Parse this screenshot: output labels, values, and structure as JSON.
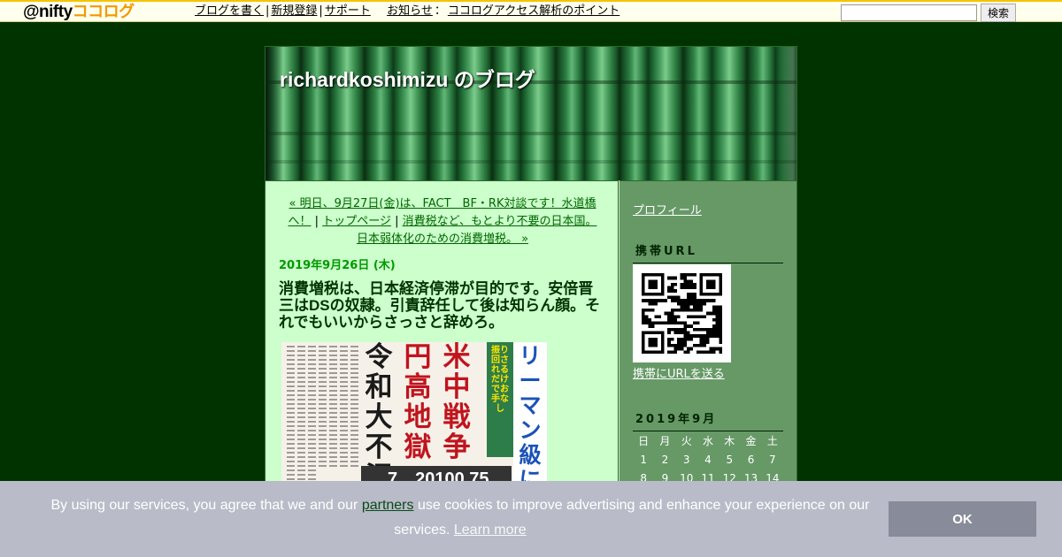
{
  "topbar": {
    "logo_at": "@nifty",
    "logo_kana": "ココログ",
    "nav": [
      {
        "label": "ブログを書く"
      },
      {
        "label": "新規登録"
      },
      {
        "label": "サポート"
      }
    ],
    "news_label": "お知らせ",
    "news_link": "ココログアクセス解析のポイント",
    "search_placeholder": "",
    "search_button": "検索"
  },
  "blog": {
    "title": "richardkoshimizu のブログ"
  },
  "pager": {
    "prev": "« 明日、9月27日(金)は、FACT　BF・RK対談です！水道橋へ！",
    "home": "トップページ",
    "next": "消費税など、もとより不要の日本国。日本弱体化のための消費増税。 »"
  },
  "entry": {
    "date": "2019年9月26日 (木)",
    "title": "消費増税は、日本経済停滞が目的です。安倍晋三はDSの奴隷。引責辞任して後は知らん顔。それでもいいからさっさと辞めろ。"
  },
  "newspaper": {
    "col1": "米中戦争",
    "col2": "円高地獄",
    "col3": "令和大不況",
    "side": "リーマン級になって",
    "strip": "振り回されるだけでお手なし",
    "figure": "7…20100.75"
  },
  "sidebar": {
    "profile": "プロフィール",
    "mobile_heading": "携帯URL",
    "send_url": "携帯にURLを送る",
    "calendar_heading": "2019年9月",
    "weekdays": [
      "日",
      "月",
      "火",
      "水",
      "木",
      "金",
      "土"
    ],
    "weeks": [
      [
        "1",
        "2",
        "3",
        "4",
        "5",
        "6",
        "7"
      ],
      [
        "8",
        "9",
        "10",
        "11",
        "12",
        "13",
        "14"
      ]
    ]
  },
  "cookie": {
    "text_before": "By using our services, you agree that we and our ",
    "partners": "partners",
    "text_after": " use cookies to improve advertising and enhance your experience on our services. ",
    "learn_more": "Learn more",
    "ok": "OK"
  }
}
